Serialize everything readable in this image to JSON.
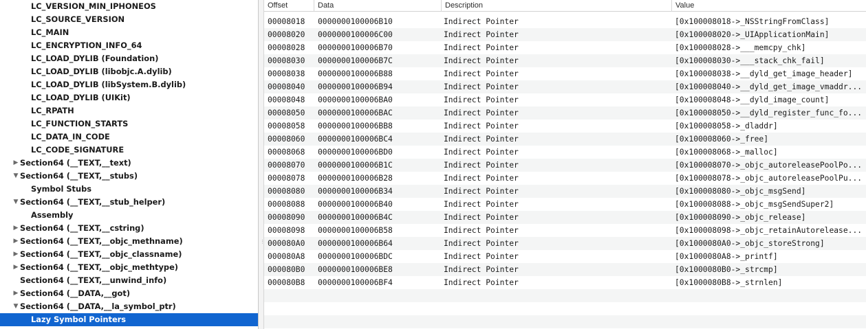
{
  "tree": {
    "items": [
      {
        "label": "LC_VERSION_MIN_IPHONEOS",
        "disclosure": "",
        "level": 1
      },
      {
        "label": "LC_SOURCE_VERSION",
        "disclosure": "",
        "level": 1
      },
      {
        "label": "LC_MAIN",
        "disclosure": "",
        "level": 1
      },
      {
        "label": "LC_ENCRYPTION_INFO_64",
        "disclosure": "",
        "level": 1
      },
      {
        "label": "LC_LOAD_DYLIB (Foundation)",
        "disclosure": "",
        "level": 1
      },
      {
        "label": "LC_LOAD_DYLIB (libobjc.A.dylib)",
        "disclosure": "",
        "level": 1
      },
      {
        "label": "LC_LOAD_DYLIB (libSystem.B.dylib)",
        "disclosure": "",
        "level": 1
      },
      {
        "label": "LC_LOAD_DYLIB (UIKit)",
        "disclosure": "",
        "level": 1
      },
      {
        "label": "LC_RPATH",
        "disclosure": "",
        "level": 1
      },
      {
        "label": "LC_FUNCTION_STARTS",
        "disclosure": "",
        "level": 1
      },
      {
        "label": "LC_DATA_IN_CODE",
        "disclosure": "",
        "level": 1
      },
      {
        "label": "LC_CODE_SIGNATURE",
        "disclosure": "",
        "level": 1
      },
      {
        "label": "Section64 (__TEXT,__text)",
        "disclosure": "collapsed",
        "level": 0
      },
      {
        "label": "Section64 (__TEXT,__stubs)",
        "disclosure": "expanded",
        "level": 0
      },
      {
        "label": "Symbol Stubs",
        "disclosure": "",
        "level": 1
      },
      {
        "label": "Section64 (__TEXT,__stub_helper)",
        "disclosure": "expanded",
        "level": 0
      },
      {
        "label": "Assembly",
        "disclosure": "",
        "level": 1
      },
      {
        "label": "Section64 (__TEXT,__cstring)",
        "disclosure": "collapsed",
        "level": 0
      },
      {
        "label": "Section64 (__TEXT,__objc_methname)",
        "disclosure": "collapsed",
        "level": 0
      },
      {
        "label": "Section64 (__TEXT,__objc_classname)",
        "disclosure": "collapsed",
        "level": 0
      },
      {
        "label": "Section64 (__TEXT,__objc_methtype)",
        "disclosure": "collapsed",
        "level": 0
      },
      {
        "label": "Section64 (__TEXT,__unwind_info)",
        "disclosure": "",
        "level": 0
      },
      {
        "label": "Section64 (__DATA,__got)",
        "disclosure": "collapsed",
        "level": 0
      },
      {
        "label": "Section64 (__DATA,__la_symbol_ptr)",
        "disclosure": "expanded",
        "level": 0
      },
      {
        "label": "Lazy Symbol Pointers",
        "disclosure": "",
        "level": 1,
        "selected": true
      }
    ]
  },
  "table": {
    "columns": [
      "Offset",
      "Data",
      "Description",
      "Value"
    ],
    "rows": [
      {
        "offset": "00008018",
        "data": "0000000100006B10",
        "description": "Indirect Pointer",
        "value": "[0x100008018->_NSStringFromClass]"
      },
      {
        "offset": "00008020",
        "data": "0000000100006C00",
        "description": "Indirect Pointer",
        "value": "[0x100008020->_UIApplicationMain]"
      },
      {
        "offset": "00008028",
        "data": "0000000100006B70",
        "description": "Indirect Pointer",
        "value": "[0x100008028->___memcpy_chk]"
      },
      {
        "offset": "00008030",
        "data": "0000000100006B7C",
        "description": "Indirect Pointer",
        "value": "[0x100008030->___stack_chk_fail]"
      },
      {
        "offset": "00008038",
        "data": "0000000100006B88",
        "description": "Indirect Pointer",
        "value": "[0x100008038->__dyld_get_image_header]"
      },
      {
        "offset": "00008040",
        "data": "0000000100006B94",
        "description": "Indirect Pointer",
        "value": "[0x100008040->__dyld_get_image_vmaddr..."
      },
      {
        "offset": "00008048",
        "data": "0000000100006BA0",
        "description": "Indirect Pointer",
        "value": "[0x100008048->__dyld_image_count]"
      },
      {
        "offset": "00008050",
        "data": "0000000100006BAC",
        "description": "Indirect Pointer",
        "value": "[0x100008050->__dyld_register_func_fo..."
      },
      {
        "offset": "00008058",
        "data": "0000000100006BB8",
        "description": "Indirect Pointer",
        "value": "[0x100008058->_dladdr]"
      },
      {
        "offset": "00008060",
        "data": "0000000100006BC4",
        "description": "Indirect Pointer",
        "value": "[0x100008060->_free]"
      },
      {
        "offset": "00008068",
        "data": "0000000100006BD0",
        "description": "Indirect Pointer",
        "value": "[0x100008068->_malloc]"
      },
      {
        "offset": "00008070",
        "data": "0000000100006B1C",
        "description": "Indirect Pointer",
        "value": "[0x100008070->_objc_autoreleasePoolPo..."
      },
      {
        "offset": "00008078",
        "data": "0000000100006B28",
        "description": "Indirect Pointer",
        "value": "[0x100008078->_objc_autoreleasePoolPu..."
      },
      {
        "offset": "00008080",
        "data": "0000000100006B34",
        "description": "Indirect Pointer",
        "value": "[0x100008080->_objc_msgSend]"
      },
      {
        "offset": "00008088",
        "data": "0000000100006B40",
        "description": "Indirect Pointer",
        "value": "[0x100008088->_objc_msgSendSuper2]"
      },
      {
        "offset": "00008090",
        "data": "0000000100006B4C",
        "description": "Indirect Pointer",
        "value": "[0x100008090->_objc_release]"
      },
      {
        "offset": "00008098",
        "data": "0000000100006B58",
        "description": "Indirect Pointer",
        "value": "[0x100008098->_objc_retainAutorelease..."
      },
      {
        "offset": "000080A0",
        "data": "0000000100006B64",
        "description": "Indirect Pointer",
        "value": "[0x1000080A0->_objc_storeStrong]"
      },
      {
        "offset": "000080A8",
        "data": "0000000100006BDC",
        "description": "Indirect Pointer",
        "value": "[0x1000080A8->_printf]"
      },
      {
        "offset": "000080B0",
        "data": "0000000100006BE8",
        "description": "Indirect Pointer",
        "value": "[0x1000080B0->_strcmp]"
      },
      {
        "offset": "000080B8",
        "data": "0000000100006BF4",
        "description": "Indirect Pointer",
        "value": "[0x1000080B8->_strnlen]"
      }
    ]
  },
  "icons": {
    "collapsed": "disclosure-triangle-right-icon",
    "expanded": "disclosure-triangle-down-icon",
    "splitter_grip": "grip-dots-icon"
  },
  "colors": {
    "selection": "#1165d0",
    "alt_row": "#f4f5f5"
  }
}
